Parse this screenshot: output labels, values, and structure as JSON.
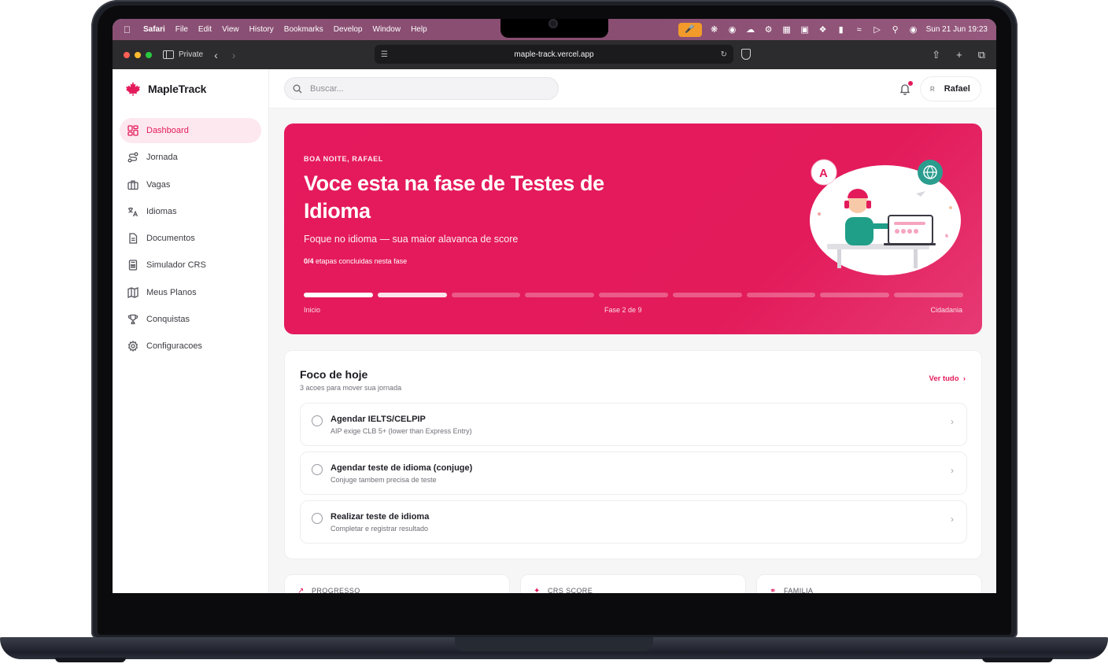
{
  "menubar": {
    "app": "Safari",
    "items": [
      "File",
      "Edit",
      "View",
      "History",
      "Bookmarks",
      "Develop",
      "Window",
      "Help"
    ],
    "datetime": "Sun 21 Jun  19:23"
  },
  "browser": {
    "private_label": "Private",
    "url": "maple-track.vercel.app"
  },
  "sidebar": {
    "brand": "MapleTrack",
    "items": [
      {
        "label": "Dashboard",
        "icon": "dashboard-icon"
      },
      {
        "label": "Jornada",
        "icon": "route-icon"
      },
      {
        "label": "Vagas",
        "icon": "briefcase-icon"
      },
      {
        "label": "Idiomas",
        "icon": "translate-icon"
      },
      {
        "label": "Documentos",
        "icon": "document-icon"
      },
      {
        "label": "Simulador CRS",
        "icon": "calculator-icon"
      },
      {
        "label": "Meus Planos",
        "icon": "map-icon"
      },
      {
        "label": "Conquistas",
        "icon": "trophy-icon"
      },
      {
        "label": "Configuracoes",
        "icon": "gear-icon"
      }
    ]
  },
  "topbar": {
    "search_placeholder": "Buscar...",
    "user_initial": "R",
    "user_name": "Rafael"
  },
  "hero": {
    "kicker": "BOA NOITE, RAFAEL",
    "title": "Voce esta na fase de Testes de Idioma",
    "subtitle": "Foque no idioma — sua maior alavanca de score",
    "steps_count": "0/4",
    "steps_text": "etapas concluidas nesta fase",
    "phase_start": "Inicio",
    "phase_current": "Fase 2 de 9",
    "phase_end": "Cidadania",
    "phase_index": 2,
    "phase_total": 9
  },
  "focus": {
    "title": "Foco de hoje",
    "subtitle": "3 acoes para mover sua jornada",
    "see_all": "Ver tudo",
    "tasks": [
      {
        "title": "Agendar IELTS/CELPIP",
        "desc": "AIP exige CLB 5+ (lower than Express Entry)"
      },
      {
        "title": "Agendar teste de idioma (conjuge)",
        "desc": "Conjuge tambem precisa de teste"
      },
      {
        "title": "Realizar teste de idioma",
        "desc": "Completar e registrar resultado"
      }
    ]
  },
  "cards": [
    {
      "label": "PROGRESSO"
    },
    {
      "label": "CRS SCORE"
    },
    {
      "label": "FAMILIA"
    }
  ],
  "colors": {
    "accent": "#e31b5b",
    "menubar": "#8a4e72",
    "toolbar": "#2c2c2e"
  }
}
